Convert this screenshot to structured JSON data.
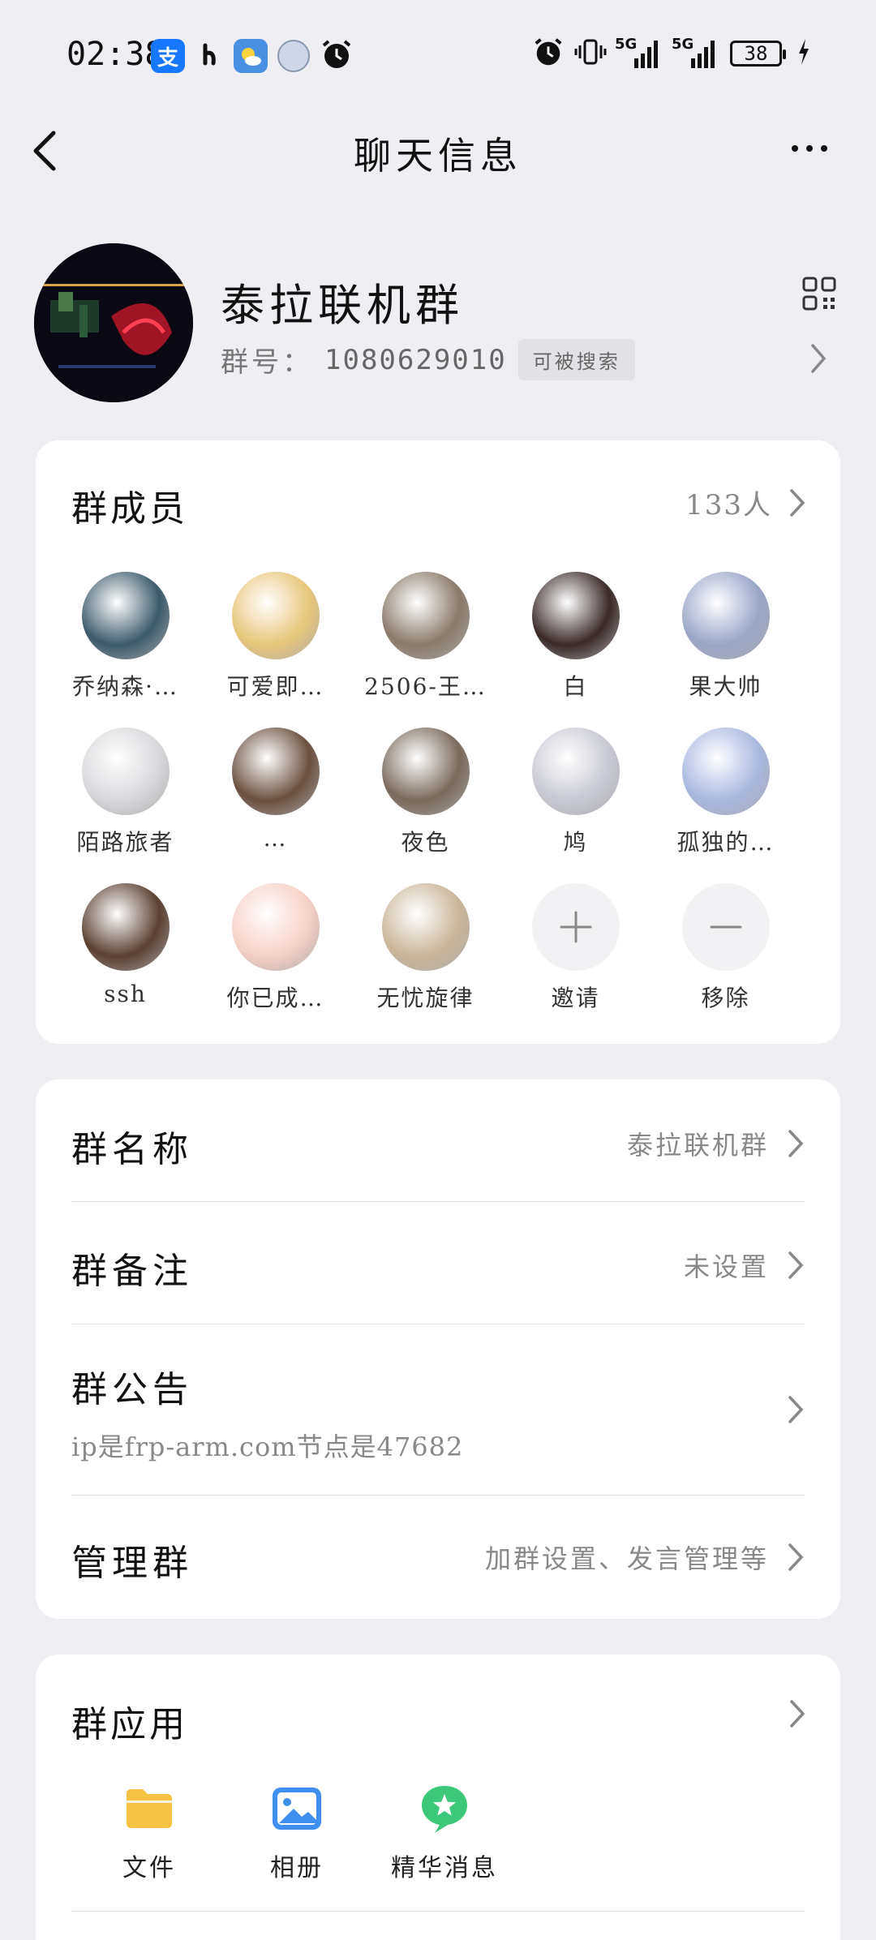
{
  "status_bar": {
    "time": "02:38",
    "alipay_glyph": "支",
    "battery": "38",
    "signal_1": "5G",
    "signal_2": "5G",
    "icons": [
      "alipay-icon",
      "qq-music-icon",
      "weather-icon",
      "avatar-app-icon",
      "alarm-icon",
      "alarm-icon",
      "vibrate-icon",
      "signal-icon",
      "signal-icon",
      "battery-icon",
      "charging-icon"
    ]
  },
  "nav": {
    "title": "聊天信息"
  },
  "group": {
    "name": "泰拉联机群",
    "id_label": "群号：",
    "id_value": "1080629010",
    "search_badge": "可被搜索"
  },
  "members": {
    "title": "群成员",
    "count": "133人",
    "list": [
      {
        "name": "乔纳森·…",
        "color": "#3d5a6a"
      },
      {
        "name": "可爱即…",
        "color": "#e8c67a"
      },
      {
        "name": "2506-王…",
        "color": "#8a7a6a"
      },
      {
        "name": "白",
        "color": "#3a2a28"
      },
      {
        "name": "果大帅",
        "color": "#9aa6c8"
      },
      {
        "name": "陌路旅者",
        "color": "#d8d8dc"
      },
      {
        "name": "…",
        "color": "#6a5040"
      },
      {
        "name": "夜色",
        "color": "#7a6a5c"
      },
      {
        "name": "鸠",
        "color": "#c8c8d4"
      },
      {
        "name": "孤独的…",
        "color": "#a9b7e0"
      },
      {
        "name": "ssh",
        "color": "#5a4032"
      },
      {
        "name": "你已成…",
        "color": "#f6d0c6"
      },
      {
        "name": "无忧旋律",
        "color": "#c9b59a"
      }
    ],
    "invite_label": "邀请",
    "remove_label": "移除"
  },
  "settings": {
    "group_name_label": "群名称",
    "group_name_value": "泰拉联机群",
    "remark_label": "群备注",
    "remark_value": "未设置",
    "notice_label": "群公告",
    "notice_value": "ip是frp-arm.com节点是47682",
    "manage_label": "管理群",
    "manage_value": "加群设置、发言管理等"
  },
  "apps": {
    "title": "群应用",
    "items": [
      {
        "label": "文件",
        "icon": "folder-icon",
        "color": "#f6c244"
      },
      {
        "label": "相册",
        "icon": "album-icon",
        "color": "#3f8ff0"
      },
      {
        "label": "精华消息",
        "icon": "essence-icon",
        "color": "#3cc77a"
      }
    ]
  }
}
